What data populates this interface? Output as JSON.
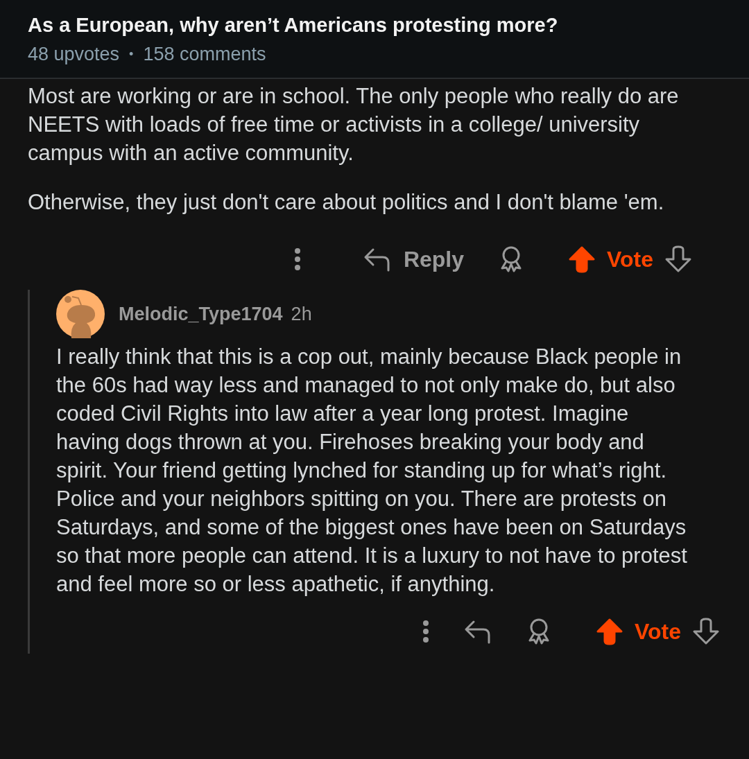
{
  "post": {
    "title": "As a European, why aren’t Americans protesting more?",
    "upvotes": "48 upvotes",
    "separator": "•",
    "comments": "158 comments"
  },
  "comments": [
    {
      "paragraphs": [
        "Most are working or are in school. The only people who really do are NEETS with loads of free time or activists in a college/ university campus with an active community.",
        "Otherwise, they just don't care about politics and I don't blame 'em."
      ],
      "actions": {
        "reply_label": "Reply",
        "vote_label": "Vote",
        "upvoted": true
      }
    },
    {
      "author": "Melodic_Type1704",
      "time": "2h",
      "paragraphs": [
        "I really think that this is a cop out, mainly because Black people in the 60s had way less and managed to not only make do, but also coded Civil Rights into law after a year long protest. Imagine having dogs thrown at you. Firehoses breaking your body and spirit. Your friend getting lynched for standing up for what’s right. Police and your neighbors spitting on you. There are protests on Saturdays, and some of the biggest ones have been on Saturdays so that more people can attend. It is a luxury to not have to protest and feel more so or less apathetic, if anything."
      ],
      "actions": {
        "vote_label": "Vote",
        "upvoted": true
      }
    }
  ]
}
